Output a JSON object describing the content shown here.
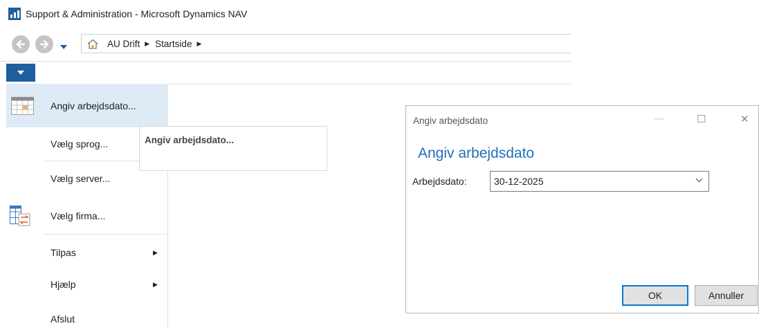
{
  "window": {
    "title": "Support & Administration - Microsoft Dynamics NAV",
    "icon": "dynamics-nav-chart-icon"
  },
  "navigation": {
    "back_icon": "back-arrow-icon",
    "forward_icon": "forward-arrow-icon",
    "history_icon": "chevron-down-icon",
    "breadcrumb": {
      "home_icon": "home-icon",
      "items": [
        "AU Drift",
        "Startside"
      ],
      "separator": "▶"
    }
  },
  "app_menu": {
    "toggle_icon": "chevron-down-icon",
    "items": [
      {
        "label": "Angiv arbejdsdato...",
        "icon": "calendar-icon",
        "selected": true
      },
      {
        "label": "Vælg sprog..."
      },
      {
        "label": "Vælg server..."
      },
      {
        "label": "Vælg firma...",
        "icon": "switch-company-icon"
      },
      {
        "label": "Tilpas",
        "submenu_arrow": "▶"
      },
      {
        "label": "Hjælp",
        "submenu_arrow": "▶"
      },
      {
        "label": "Afslut"
      }
    ]
  },
  "flyout": {
    "text": "Angiv arbejdsdato..."
  },
  "dialog": {
    "title": "Angiv arbejdsdato",
    "heading": "Angiv arbejdsdato",
    "controls": {
      "minimize": "—",
      "maximize": "☐",
      "close": "✕"
    },
    "field": {
      "label": "Arbejdsdato:",
      "value": "30-12-2025"
    },
    "buttons": {
      "ok": "OK",
      "cancel": "Annuller"
    }
  },
  "colors": {
    "accent": "#1e5f9e",
    "heading_blue": "#1e6fb9",
    "selection": "#deebf7",
    "ok_border": "#0078d7"
  }
}
